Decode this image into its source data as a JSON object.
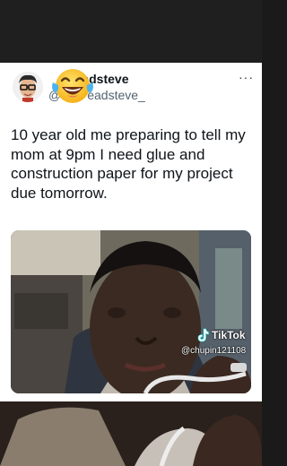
{
  "post": {
    "author_name_visible": "adsteve",
    "author_name_hidden": "S",
    "author_handle_prefix": "@",
    "author_handle_hidden": "s",
    "author_handle_visible": "eadsteve_",
    "more_label": "···",
    "text": "10 year old me preparing to tell my mom at 9pm I need glue and construction paper for my project due tomorrow."
  },
  "overlay": {
    "emoji": "laughing-crying-emoji"
  },
  "video_watermark": {
    "app_name": "TikTok",
    "handle": "@chupin121108"
  }
}
